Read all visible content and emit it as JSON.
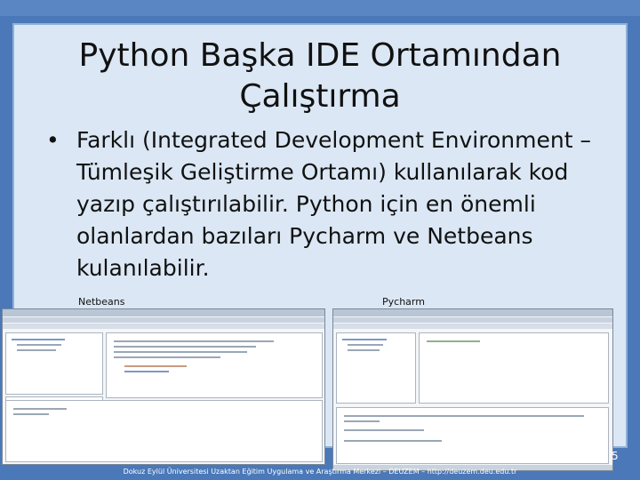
{
  "slide": {
    "title_line1": "Python Başka IDE Ortamından",
    "title_line2": "Çalıştırma",
    "bullet_symbol": "•",
    "bullet_text": "Farklı (Integrated Development Environment – Tümleşik Geliştirme Ortamı) kullanılarak kod yazıp çalıştırılabilir. Python için en önemli olanlardan bazıları Pycharm ve Netbeans kulanılabilir.",
    "netbeans_caption": "Netbeans",
    "pycharm_caption": "Pycharm",
    "page_number": "5",
    "footer": "Dokuz Eylül Üniversitesi Uzaktan Eğitim Uygulama ve Araştırma Merkezi – DEUZEM – http://deuzem.deu.edu.tr"
  },
  "colors": {
    "background": "#4a78b8",
    "panel": "#dbe7f4",
    "text": "#111111",
    "footer_text": "#ffffff"
  }
}
